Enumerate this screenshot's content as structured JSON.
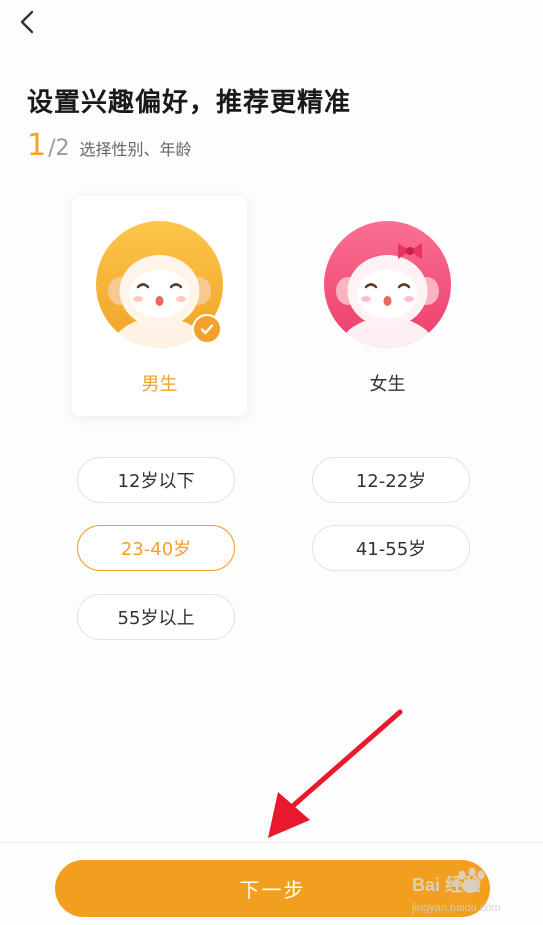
{
  "header": {
    "title": "设置兴趣偏好，推荐更精准"
  },
  "step": {
    "current": "1",
    "separator": "/",
    "total": "2",
    "description": "选择性别、年龄"
  },
  "genders": [
    {
      "label": "男生",
      "selected": true
    },
    {
      "label": "女生",
      "selected": false
    }
  ],
  "ages": [
    {
      "label": "12岁以下",
      "selected": false
    },
    {
      "label": "12-22岁",
      "selected": false
    },
    {
      "label": "23-40岁",
      "selected": true
    },
    {
      "label": "41-55岁",
      "selected": false
    },
    {
      "label": "55岁以上",
      "selected": false
    }
  ],
  "footer": {
    "next_label": "下一步"
  },
  "watermark": {
    "brand": "Bai 经验",
    "url": "jingyan.baidu.com"
  },
  "colors": {
    "accent": "#f2a12a",
    "button": "#f29f1f",
    "male_avatar": "#f7b733",
    "female_avatar": "#f04e78",
    "annotation_arrow": "#e8192c"
  },
  "icons": {
    "back": "chevron-left-icon",
    "check": "check-icon",
    "male": "boy-avatar-icon",
    "female": "girl-avatar-icon",
    "arrow": "annotation-arrow-icon",
    "watermark": "baidu-paw-icon"
  }
}
